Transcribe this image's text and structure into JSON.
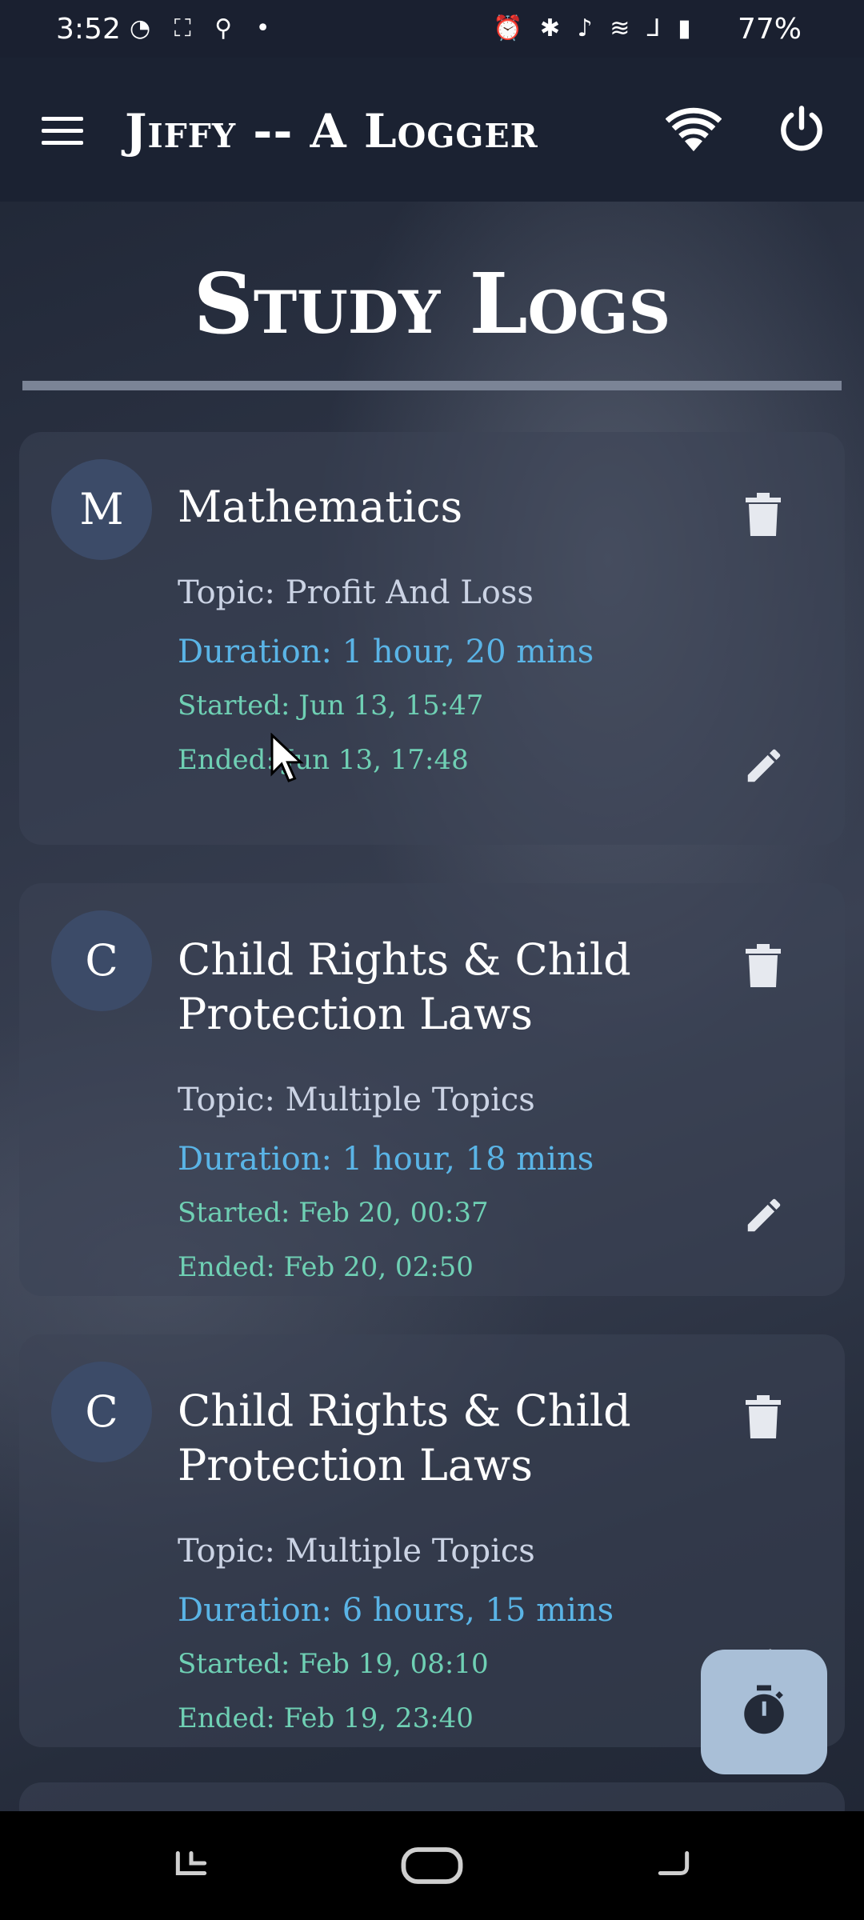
{
  "status_bar": {
    "time": "3:52",
    "left_icons": "◔ ⛶ ⚲ •",
    "right_icons": "⏰ ✱ ♪ ≋ ⅃ ▮",
    "battery": "77%"
  },
  "app_bar": {
    "title": "Jiffy -- A Logger",
    "menu_icon": "hamburger-menu-icon",
    "wifi_icon": "wifi-icon",
    "power_icon": "power-icon"
  },
  "page": {
    "title": "Study Logs"
  },
  "logs": [
    {
      "avatar": "M",
      "title": "Mathematics",
      "topic": "Topic: Profit And Loss",
      "duration": "Duration: 1 hour, 20 mins",
      "started": "Started: Jun 13, 15:47",
      "ended": "Ended: Jun 13, 17:48"
    },
    {
      "avatar": "C",
      "title": "Child Rights & Child Protection Laws",
      "topic": "Topic: Multiple Topics",
      "duration": "Duration: 1 hour, 18 mins",
      "started": "Started: Feb 20, 00:37",
      "ended": "Ended: Feb 20, 02:50"
    },
    {
      "avatar": "C",
      "title": "Child Rights & Child Protection Laws",
      "topic": "Topic: Multiple Topics",
      "duration": "Duration: 6 hours, 15 mins",
      "started": "Started: Feb 19, 08:10",
      "ended": "Ended: Feb 19, 23:40"
    }
  ],
  "fab": {
    "icon": "stopwatch-icon"
  },
  "colors": {
    "duration": "#5ab4e6",
    "timestamps": "#6fd0b4",
    "topic": "#cbd3e4",
    "fab": "#a9bfd7",
    "avatar": "#3c4b68"
  }
}
